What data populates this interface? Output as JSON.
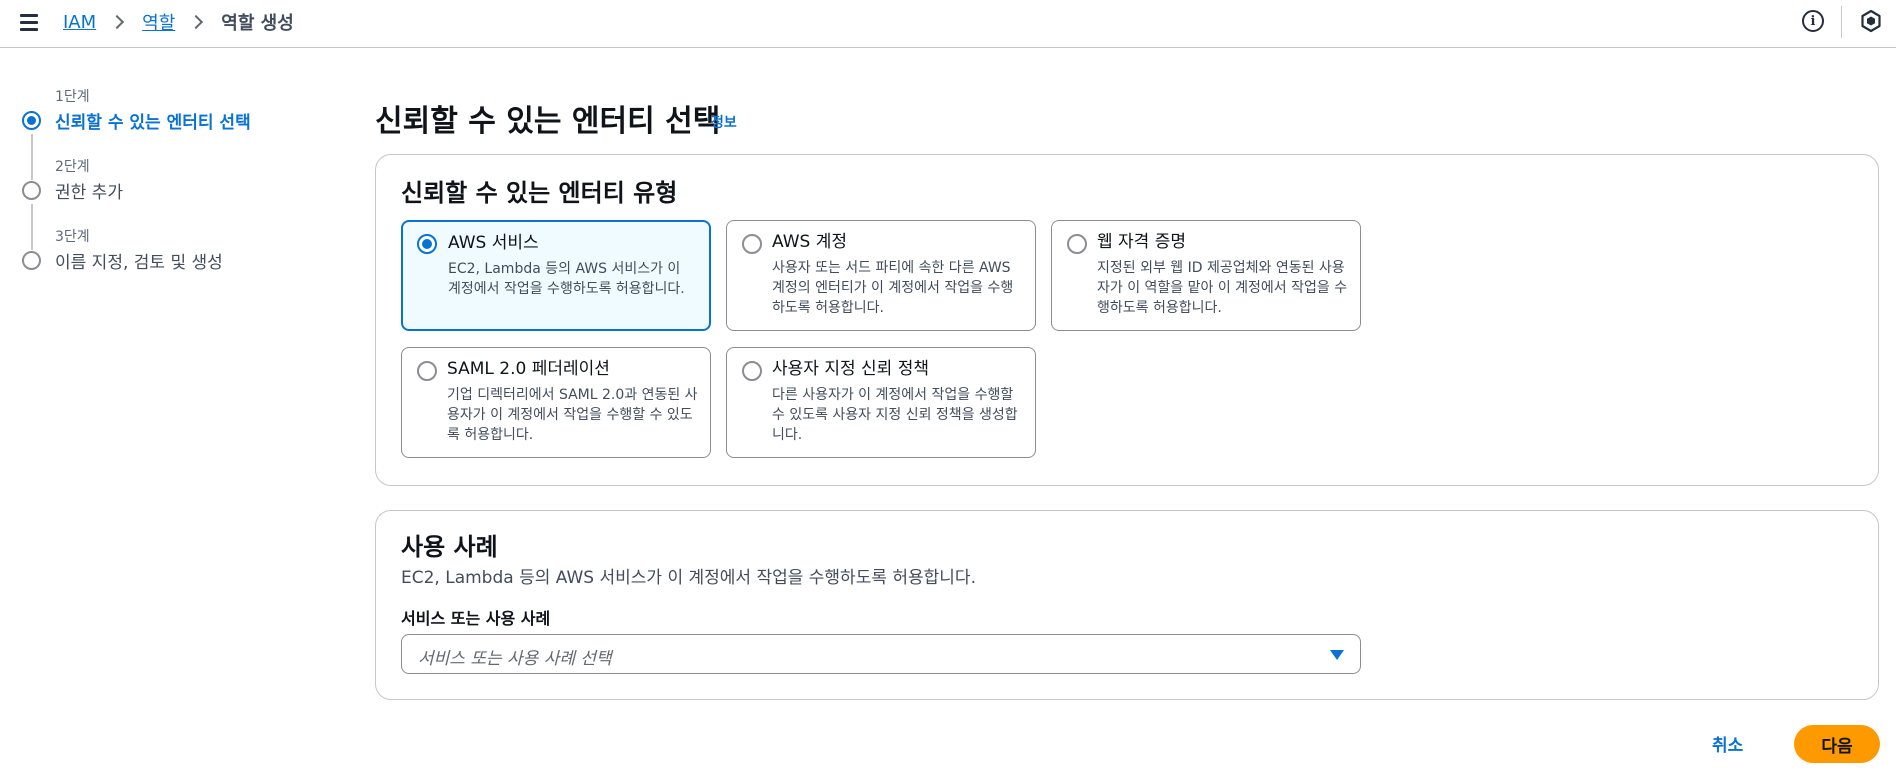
{
  "breadcrumb": {
    "items": [
      "IAM",
      "역할",
      "역할 생성"
    ]
  },
  "wizard": {
    "steps": [
      {
        "number": "1단계",
        "label": "신뢰할 수 있는 엔터티 선택",
        "state": "active"
      },
      {
        "number": "2단계",
        "label": "권한 추가",
        "state": "pending"
      },
      {
        "number": "3단계",
        "label": "이름 지정, 검토 및 생성",
        "state": "pending"
      }
    ]
  },
  "page": {
    "title": "신뢰할 수 있는 엔터티 선택",
    "info_link": "정보"
  },
  "entity_types": {
    "title": "신뢰할 수 있는 엔터티 유형",
    "selected": "aws-service",
    "options": [
      {
        "id": "aws-service",
        "title": "AWS 서비스",
        "description": "EC2, Lambda 등의 AWS 서비스가 이 계정에서 작업을 수행하도록 허용합니다."
      },
      {
        "id": "aws-account",
        "title": "AWS 계정",
        "description": "사용자 또는 서드 파티에 속한 다른 AWS 계정의 엔터티가 이 계정에서 작업을 수행하도록 허용합니다."
      },
      {
        "id": "web-identity",
        "title": "웹 자격 증명",
        "description": "지정된 외부 웹 ID 제공업체와 연동된 사용자가 이 역할을 맡아 이 계정에서 작업을 수행하도록 허용합니다."
      },
      {
        "id": "saml-federation",
        "title": "SAML 2.0 페더레이션",
        "description": "기업 디렉터리에서 SAML 2.0과 연동된 사용자가 이 계정에서 작업을 수행할 수 있도록 허용합니다."
      },
      {
        "id": "custom-trust-policy",
        "title": "사용자 지정 신뢰 정책",
        "description": "다른 사용자가 이 계정에서 작업을 수행할 수 있도록 사용자 지정 신뢰 정책을 생성합니다."
      }
    ]
  },
  "use_case": {
    "title": "사용 사례",
    "description": "EC2, Lambda 등의 AWS 서비스가 이 계정에서 작업을 수행하도록 허용합니다.",
    "field_label": "서비스 또는 사용 사례",
    "placeholder": "서비스 또는 사용 사례 선택"
  },
  "actions": {
    "cancel": "취소",
    "next": "다음"
  },
  "icons": {
    "menu": "hamburger-menu-icon",
    "info": "info-circle-icon",
    "shield": "shield-icon",
    "dropdown": "caret-down-icon"
  },
  "colors": {
    "accent": "#0972d3",
    "primary_button": "#ff9900",
    "selected_tile_bg": "#f0fbff"
  }
}
